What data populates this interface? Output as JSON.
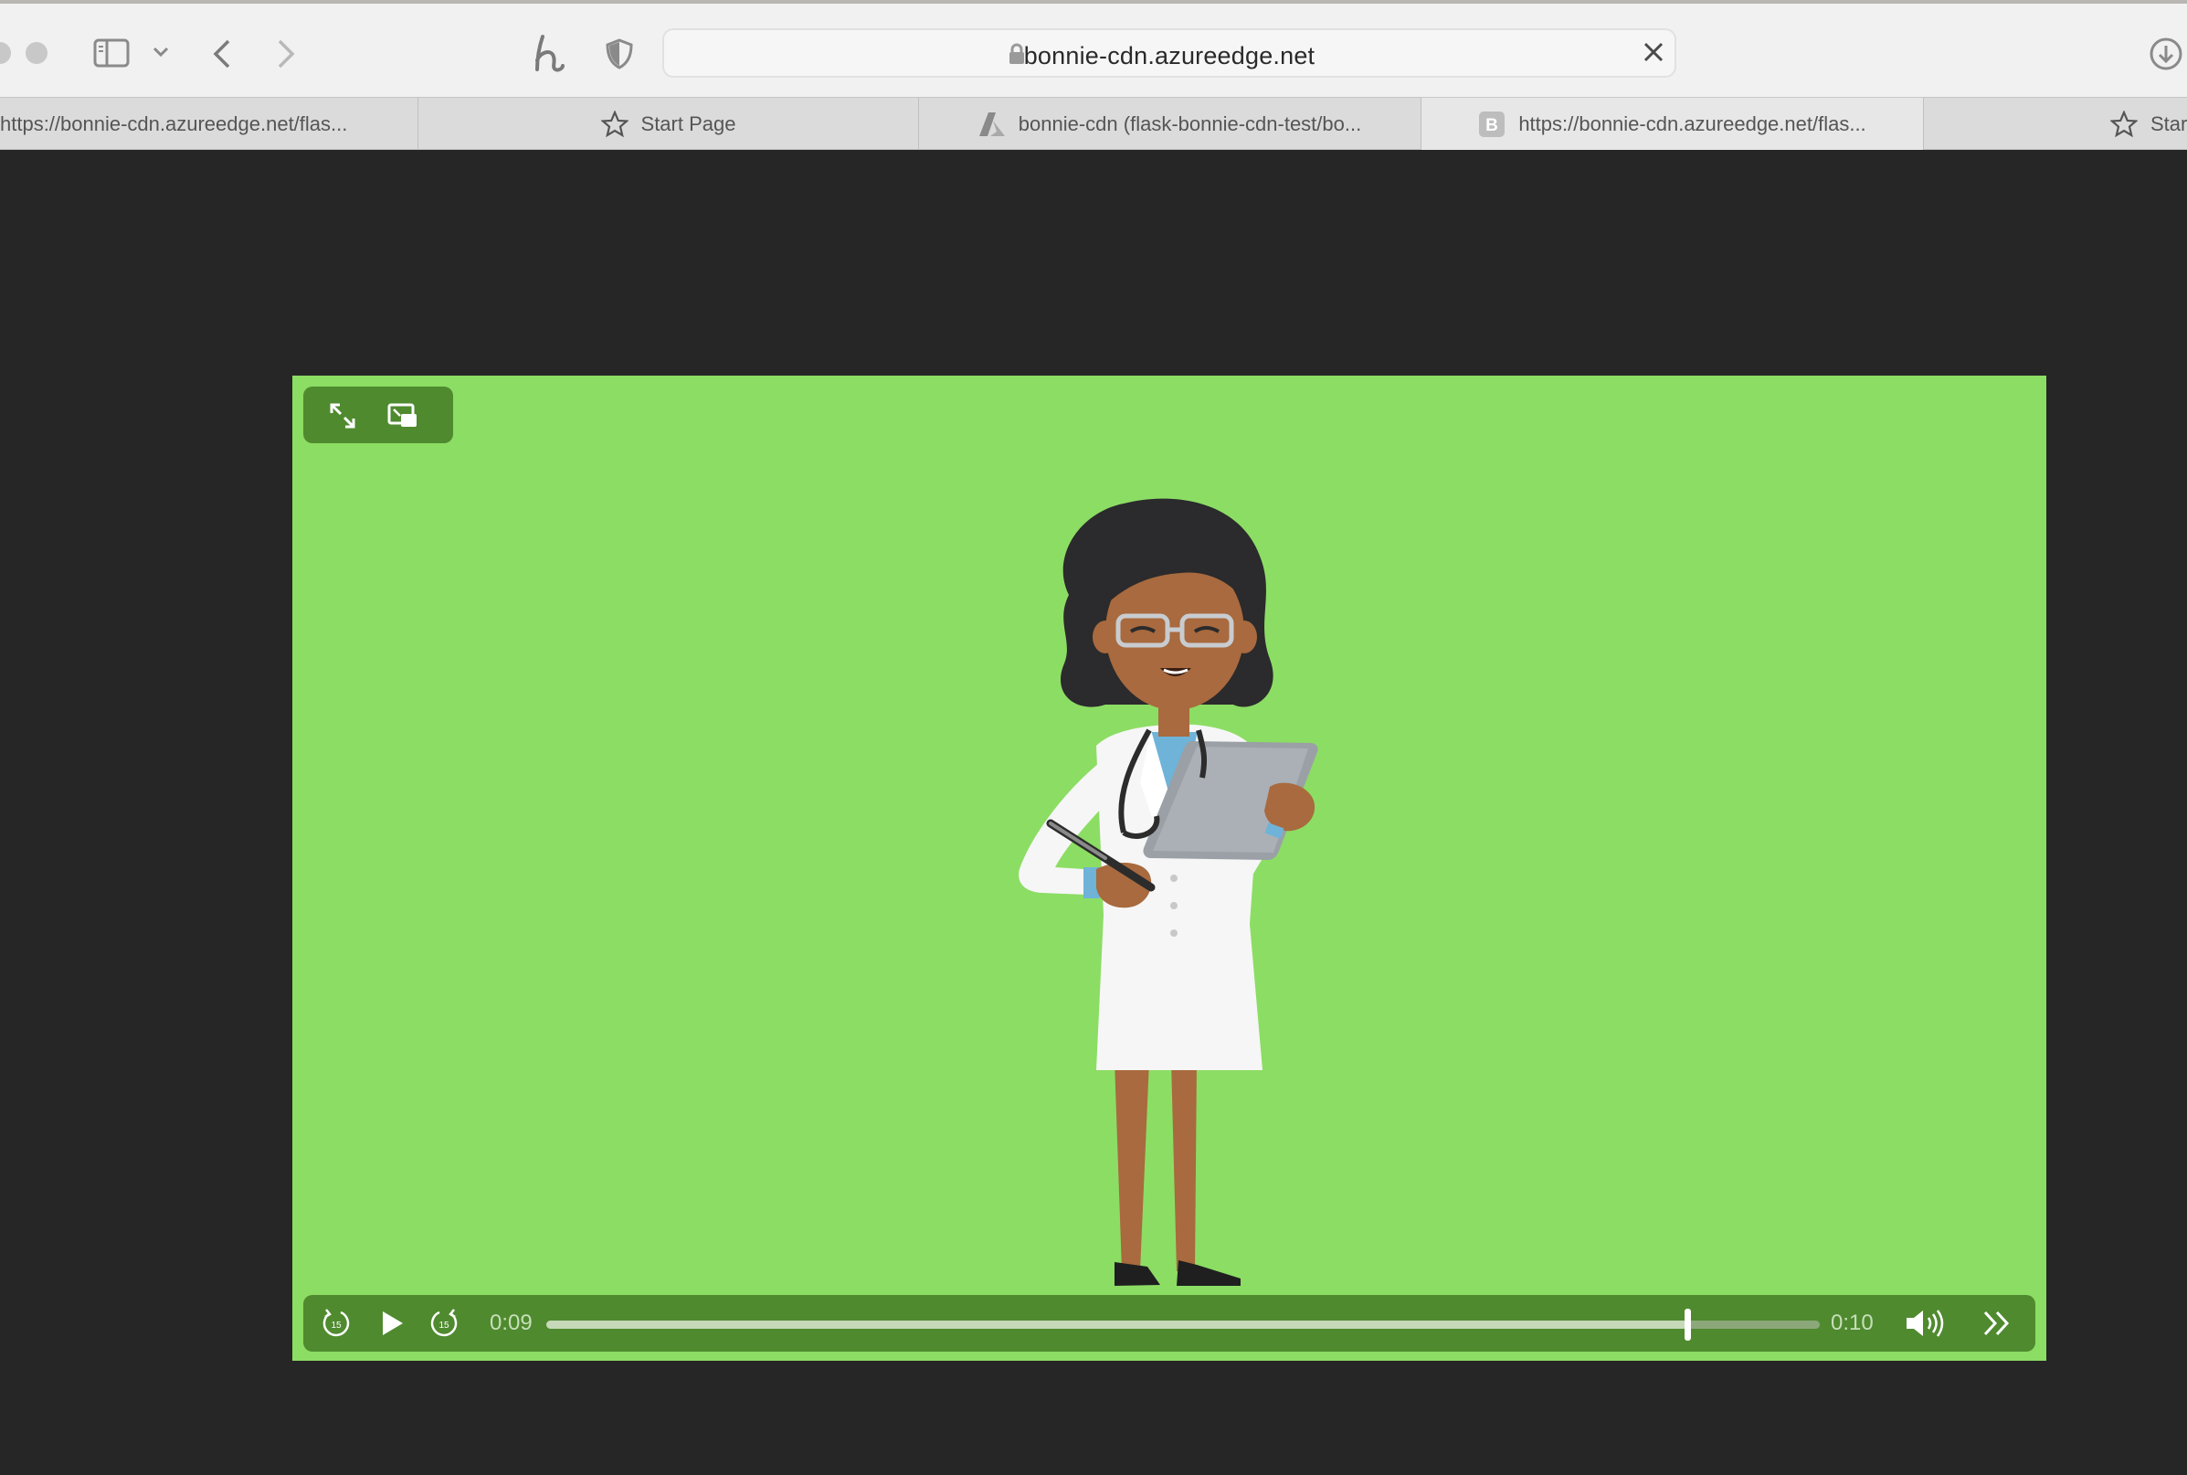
{
  "browser": {
    "url": "bonnie-cdn.azureedge.net",
    "tabs": [
      {
        "label": "https://bonnie-cdn.azureedge.net/flas...",
        "icon": "none"
      },
      {
        "label": "Start Page",
        "icon": "star-icon"
      },
      {
        "label": "bonnie-cdn (flask-bonnie-cdn-test/bo...",
        "icon": "azure-icon"
      },
      {
        "label": "https://bonnie-cdn.azureedge.net/flas...",
        "icon": "b-favicon",
        "icon_letter": "B"
      },
      {
        "label": "Start",
        "icon": "star-icon"
      }
    ]
  },
  "video": {
    "current_time": "0:09",
    "duration": "0:10",
    "progress": 0.896,
    "background_color": "#8cdd64",
    "controls_color": "#4f8a2f",
    "skip_back_label": "15",
    "skip_forward_label": "15"
  }
}
